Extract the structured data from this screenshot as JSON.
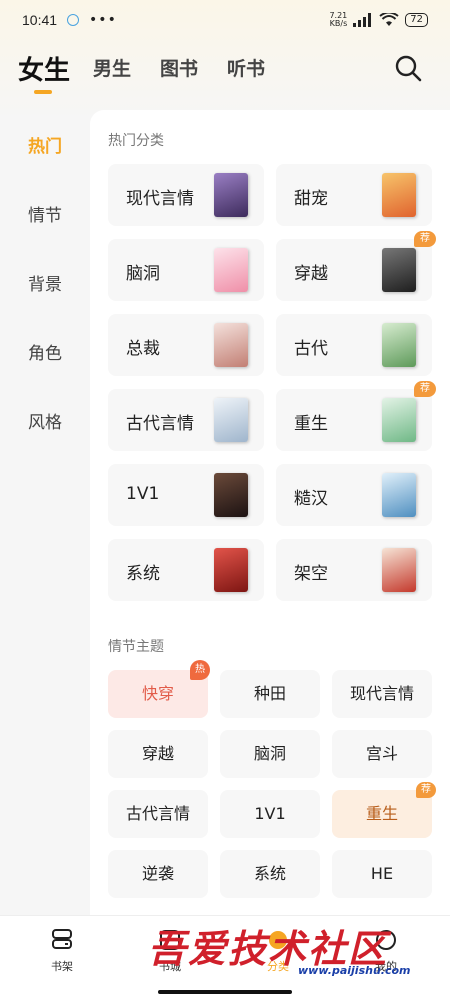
{
  "status_bar": {
    "time": "10:41",
    "dots": "•••",
    "speed_value": "7.21",
    "speed_unit": "KB/s",
    "battery": "72"
  },
  "top_tabs": [
    {
      "label": "女生",
      "active": true
    },
    {
      "label": "男生"
    },
    {
      "label": "图书"
    },
    {
      "label": "听书"
    }
  ],
  "side_nav": [
    {
      "label": "热门",
      "active": true
    },
    {
      "label": "情节"
    },
    {
      "label": "背景"
    },
    {
      "label": "角色"
    },
    {
      "label": "风格"
    }
  ],
  "hot_categories": {
    "title": "热门分类",
    "items": [
      {
        "label": "现代言情",
        "cover": "#6a4a8c"
      },
      {
        "label": "甜宠",
        "cover": "#e8804a"
      },
      {
        "label": "脑洞",
        "cover": "#f3b7c6"
      },
      {
        "label": "穿越",
        "cover": "#3a3a3a",
        "badge": "荐"
      },
      {
        "label": "总裁",
        "cover": "#e9c9c4"
      },
      {
        "label": "古代",
        "cover": "#8fb98a"
      },
      {
        "label": "古代言情",
        "cover": "#cfd9e6"
      },
      {
        "label": "重生",
        "cover": "#a9d6b7",
        "badge": "荐"
      },
      {
        "label": "1V1",
        "cover": "#3b2a2a"
      },
      {
        "label": "糙汉",
        "cover": "#7fb3d8"
      },
      {
        "label": "系统",
        "cover": "#b8322a"
      },
      {
        "label": "架空",
        "cover": "#c8453a"
      }
    ]
  },
  "plot_themes": {
    "title": "情节主题",
    "items": [
      {
        "label": "快穿",
        "style": "hot",
        "badge": "热"
      },
      {
        "label": "种田"
      },
      {
        "label": "现代言情"
      },
      {
        "label": "穿越"
      },
      {
        "label": "脑洞"
      },
      {
        "label": "宫斗"
      },
      {
        "label": "古代言情"
      },
      {
        "label": "1V1"
      },
      {
        "label": "重生",
        "style": "rec",
        "badge": "荐"
      },
      {
        "label": "逆袭"
      },
      {
        "label": "系统"
      },
      {
        "label": "HE"
      }
    ]
  },
  "bottom_nav": [
    {
      "label": "书架"
    },
    {
      "label": "书城"
    },
    {
      "label": "分类"
    },
    {
      "label": "我的"
    }
  ],
  "watermark": {
    "text": "吾爱技术社区",
    "url": "www.paijishu.com"
  },
  "colors": {
    "accent": "#f5a623",
    "hot": "#e25c4a",
    "badge": "#f39a3c"
  }
}
